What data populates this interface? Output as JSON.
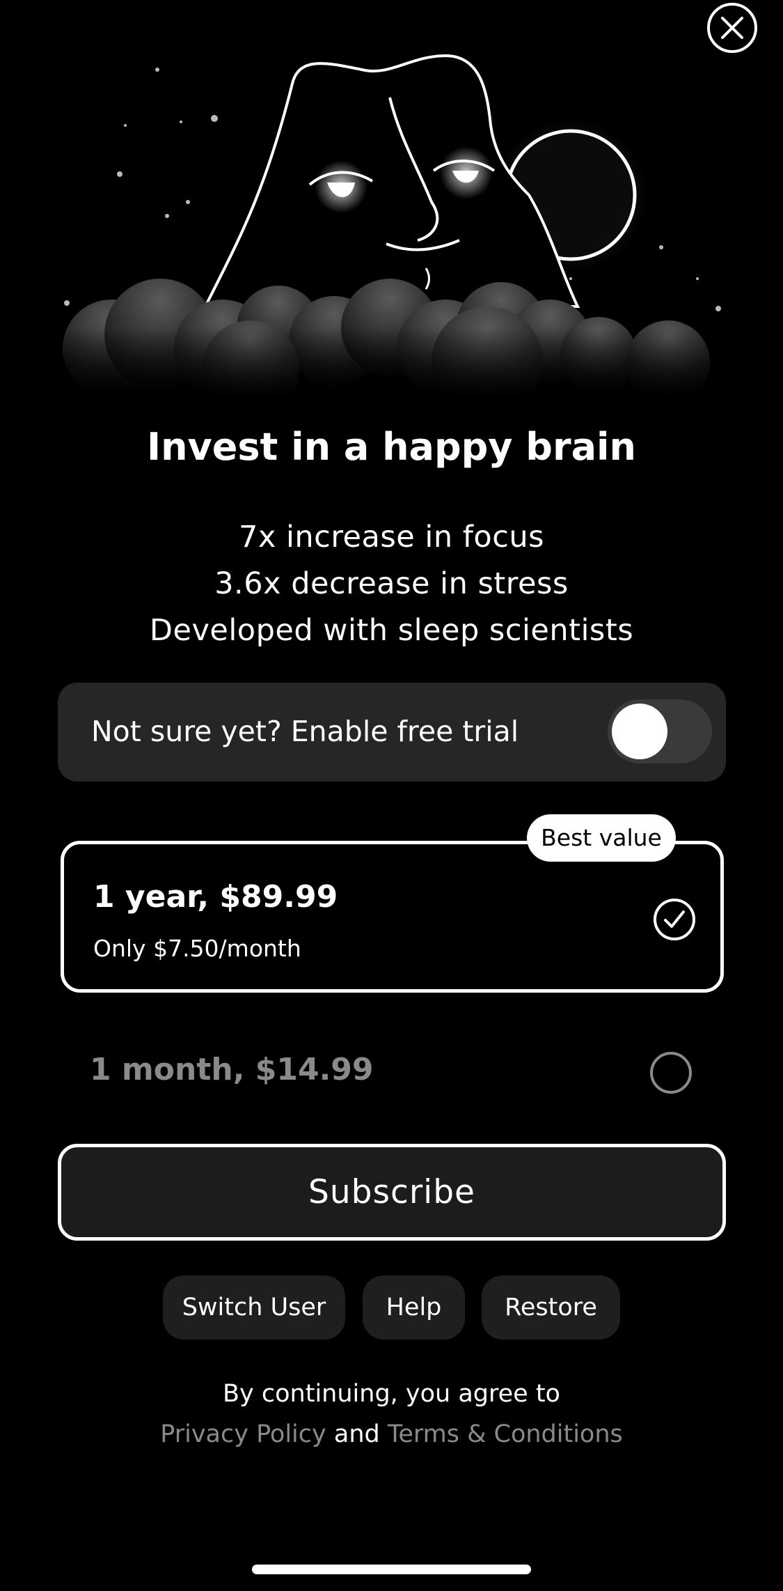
{
  "header": {
    "close_icon": "close-icon"
  },
  "hero": {
    "illustration": "moon-mountain-face-illustration"
  },
  "title": "Invest in a happy brain",
  "features": [
    "7x increase in focus",
    "3.6x decrease in stress",
    "Developed with sleep scientists"
  ],
  "trial": {
    "label": "Not sure yet? Enable free trial",
    "enabled": false
  },
  "plans": {
    "yearly": {
      "badge": "Best value",
      "title": "1 year, $89.99",
      "subtitle": "Only $7.50/month",
      "selected": true
    },
    "monthly": {
      "title": "1 month, $14.99",
      "selected": false
    }
  },
  "subscribe_label": "Subscribe",
  "links": {
    "switch_user": "Switch User",
    "help": "Help",
    "restore": "Restore"
  },
  "legal": {
    "prefix": "By continuing, you agree to",
    "privacy": "Privacy Policy",
    "and": "and",
    "terms": "Terms & Conditions"
  },
  "colors": {
    "background": "#000000",
    "card": "#262628",
    "muted": "#8a8a8c"
  }
}
